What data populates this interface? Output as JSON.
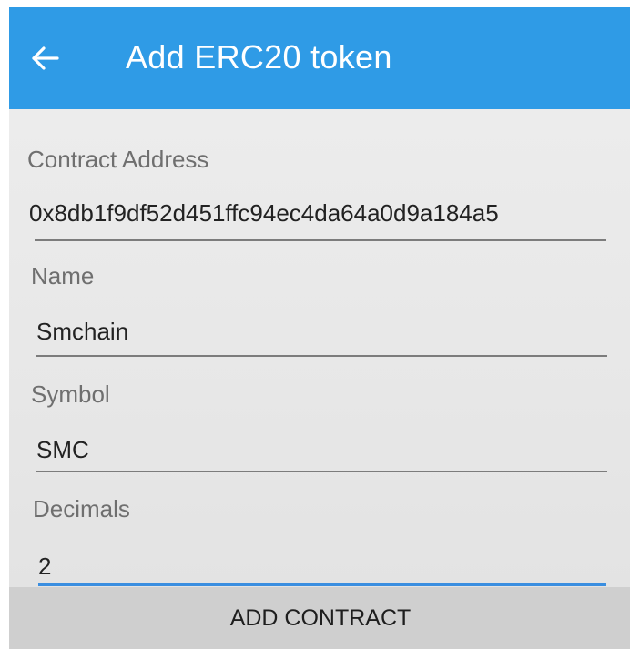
{
  "app_bar": {
    "title": "Add ERC20 token",
    "background": "#2f9be6",
    "back_icon": "arrow-left-icon"
  },
  "form": {
    "contract_address": {
      "label": "Contract Address",
      "value": "0x8db1f9df52d451ffc94ec4da64a0d9a184a5"
    },
    "name": {
      "label": "Name",
      "value": "Smchain"
    },
    "symbol": {
      "label": "Symbol",
      "value": "SMC"
    },
    "decimals": {
      "label": "Decimals",
      "value": "2",
      "focused": true,
      "focus_color": "#3a8ee0"
    }
  },
  "actions": {
    "add_contract_label": "ADD CONTRACT"
  }
}
